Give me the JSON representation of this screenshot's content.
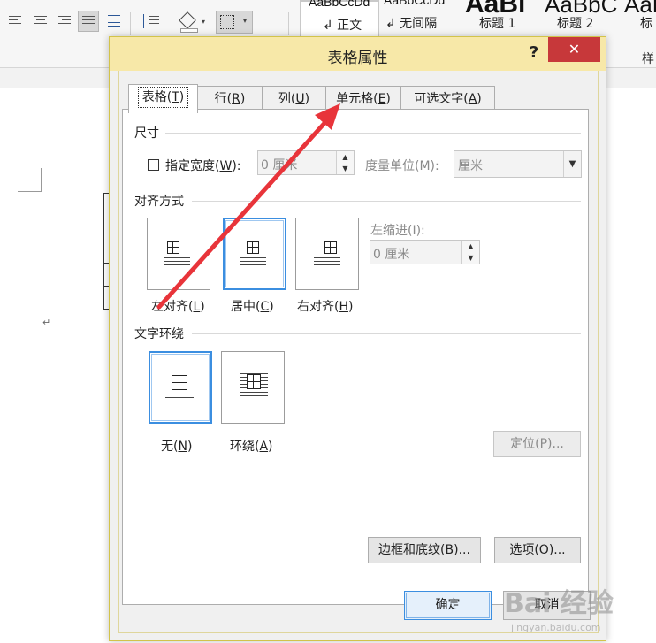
{
  "ribbon": {
    "styles": [
      {
        "preview": "AaBbCcDd",
        "label": "↲ 正文"
      },
      {
        "preview": "AaBbCcDd",
        "label": "↲ 无间隔"
      },
      {
        "preview": "AaBl",
        "label": "标题 1"
      },
      {
        "preview": "AaBbC",
        "label": "标题 2"
      },
      {
        "preview": "AaB",
        "label": "标"
      }
    ],
    "styles_group_label": "样"
  },
  "document": {
    "paragraph_mark": "↵"
  },
  "dialog": {
    "title": "表格属性",
    "help_label": "?",
    "close_label": "✕",
    "tabs": [
      {
        "label": "表格",
        "key": "T"
      },
      {
        "label": "行",
        "key": "R"
      },
      {
        "label": "列",
        "key": "U"
      },
      {
        "label": "单元格",
        "key": "E"
      },
      {
        "label": "可选文字",
        "key": "A"
      }
    ],
    "size_section": {
      "title": "尺寸",
      "preferred_width_label": "指定宽度",
      "preferred_width_key": "W",
      "width_value": "0 厘米",
      "measure_label": "度量单位(M):",
      "measure_value": "厘米"
    },
    "alignment_section": {
      "title": "对齐方式",
      "options": [
        {
          "label": "左对齐",
          "key": "L",
          "selected": false
        },
        {
          "label": "居中",
          "key": "C",
          "selected": true
        },
        {
          "label": "右对齐",
          "key": "H",
          "selected": false
        }
      ],
      "indent_label": "左缩进(I):",
      "indent_value": "0 厘米"
    },
    "wrapping_section": {
      "title": "文字环绕",
      "options": [
        {
          "label": "无",
          "key": "N",
          "selected": true
        },
        {
          "label": "环绕",
          "key": "A",
          "selected": false
        }
      ],
      "position_button": "定位(P)..."
    },
    "borders_button": "边框和底纹(B)...",
    "options_button": "选项(O)...",
    "ok_button": "确定",
    "cancel_button": "取消"
  },
  "watermark": {
    "brand": "Bai 经验",
    "url": "jingyan.baidu.com"
  },
  "colors": {
    "title_bar": "#f7e8a8",
    "close_button": "#c7383a",
    "selection_blue": "#3b8ee0",
    "annotation_arrow": "#e8343a"
  }
}
